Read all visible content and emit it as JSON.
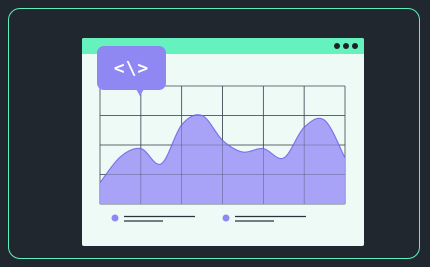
{
  "badge": {
    "code_label": "<\\>"
  },
  "window": {
    "titlebar_color": "#66f2bf",
    "background": "#eefaf6",
    "menu_icon": "more-dots-icon"
  },
  "chart_data": {
    "type": "area",
    "x": [
      0,
      1,
      2,
      3,
      4,
      5,
      6,
      7,
      8,
      9,
      10,
      11,
      12
    ],
    "values": [
      18,
      40,
      47,
      34,
      67,
      75,
      54,
      44,
      47,
      39,
      65,
      71,
      39
    ],
    "ylim": [
      0,
      100
    ],
    "grid": true,
    "fill_color": "#a49ef7",
    "stroke_color": "#7d74ec",
    "legend_position": "bottom-left",
    "legend": [
      {
        "marker_color": "#8f87f2"
      },
      {
        "marker_color": "#8f87f2"
      }
    ]
  }
}
